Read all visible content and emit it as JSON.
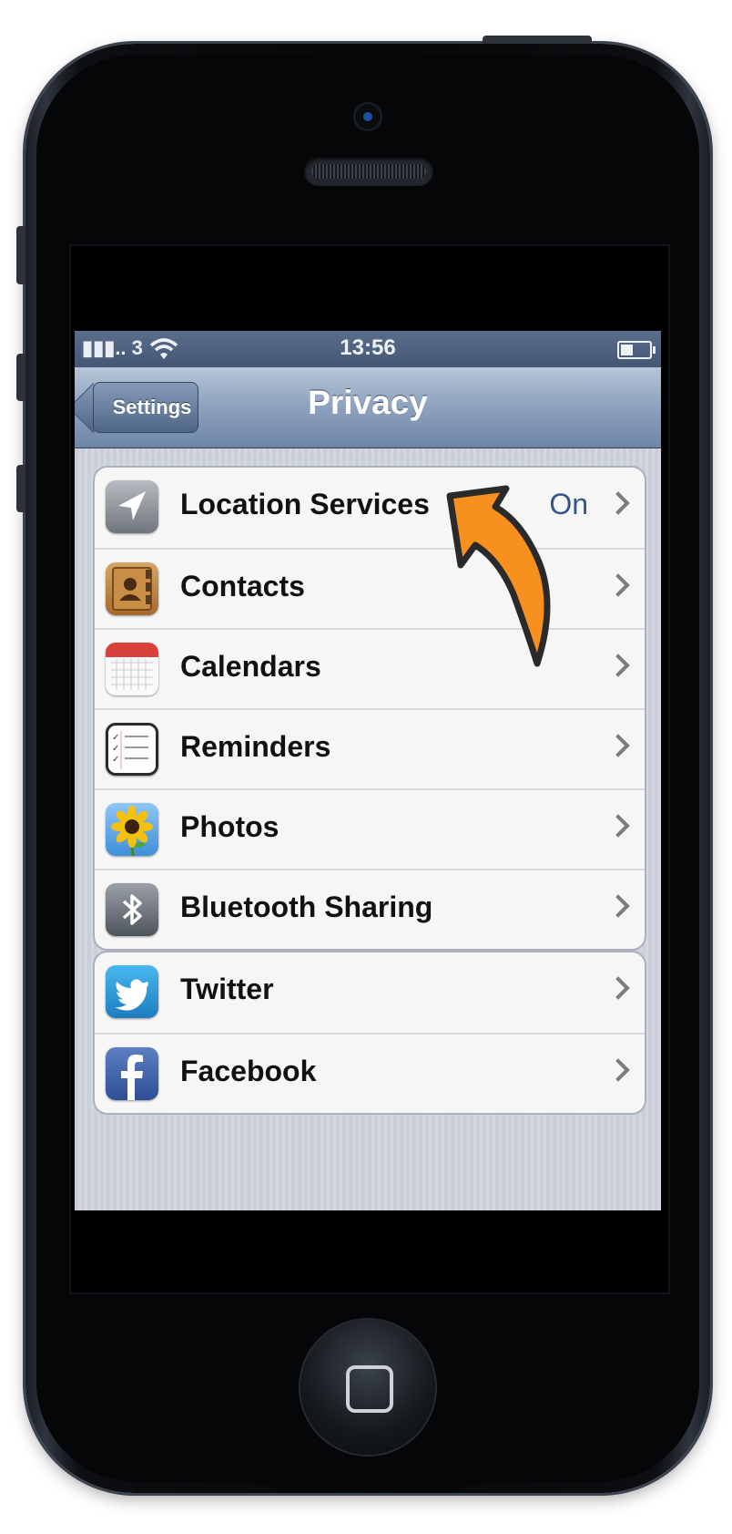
{
  "status_bar": {
    "signal": "3",
    "time": "13:56"
  },
  "nav": {
    "back_label": "Settings",
    "title": "Privacy"
  },
  "privacy_group": [
    {
      "label": "Location Services",
      "value": "On",
      "icon": "location-arrow-icon"
    },
    {
      "label": "Contacts",
      "icon": "contacts-icon"
    },
    {
      "label": "Calendars",
      "icon": "calendar-icon"
    },
    {
      "label": "Reminders",
      "icon": "reminders-icon"
    },
    {
      "label": "Photos",
      "icon": "photos-sunflower-icon"
    },
    {
      "label": "Bluetooth Sharing",
      "icon": "bluetooth-icon"
    }
  ],
  "social_group": [
    {
      "label": "Twitter",
      "icon": "twitter-bird-icon"
    },
    {
      "label": "Facebook",
      "icon": "facebook-f-icon"
    }
  ],
  "colors": {
    "accent_arrow": "#f7901e",
    "nav_bar": "#6f86a6",
    "value_text": "#385487"
  }
}
